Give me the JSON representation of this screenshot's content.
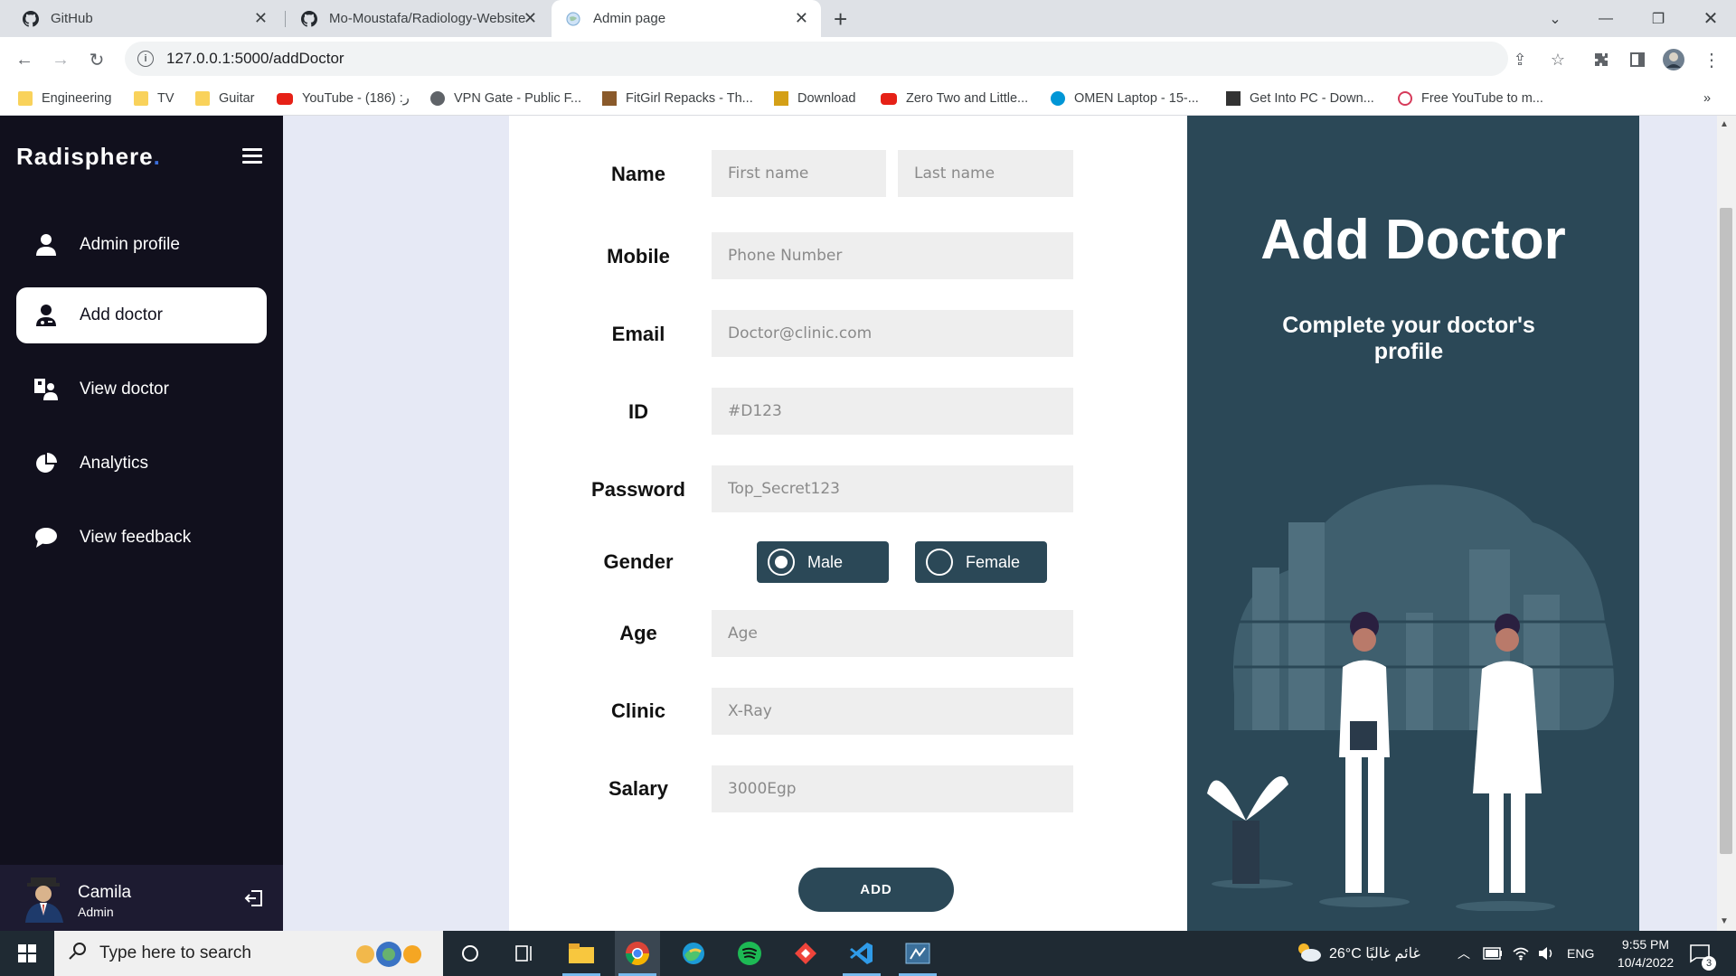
{
  "browser": {
    "tabs": [
      {
        "title": "GitHub",
        "close": "✕"
      },
      {
        "title": "Mo-Moustafa/Radiology-Website",
        "close": "✕"
      },
      {
        "title": "Admin page",
        "close": "✕"
      }
    ],
    "new_tab": "+",
    "url": "127.0.0.1:5000/addDoctor",
    "bookmarks": [
      {
        "label": "Engineering",
        "color": "#f9d25b"
      },
      {
        "label": "TV",
        "color": "#f9d25b"
      },
      {
        "label": "Guitar",
        "color": "#f9d25b"
      },
      {
        "label": "YouTube - ر: (186)",
        "color": "#e62117"
      },
      {
        "label": "VPN Gate - Public F...",
        "color": "#5f6368"
      },
      {
        "label": "FitGirl Repacks - Th...",
        "color": "#8a5a2b"
      },
      {
        "label": "Download",
        "color": "#d4a017"
      },
      {
        "label": "Zero Two and Little...",
        "color": "#e62117"
      },
      {
        "label": "OMEN Laptop - 15-...",
        "color": "#0096d6"
      },
      {
        "label": "Get Into PC - Down...",
        "color": "#333333"
      },
      {
        "label": "Free YouTube to m...",
        "color": "#d63a5a"
      }
    ],
    "more_bookmarks": "»"
  },
  "sidebar": {
    "brand": "Radisphere",
    "brand_dot": ".",
    "items": [
      {
        "label": "Admin profile",
        "icon": "user-icon"
      },
      {
        "label": "Add doctor",
        "icon": "user-doctor-icon"
      },
      {
        "label": "View doctor",
        "icon": "id-card-icon"
      },
      {
        "label": "Analytics",
        "icon": "pie-chart-icon"
      },
      {
        "label": "View feedback",
        "icon": "chat-bubble-icon"
      }
    ],
    "active_index": 1,
    "profile": {
      "name": "Camila",
      "role": "Admin"
    }
  },
  "form": {
    "fields": {
      "name": {
        "label": "Name",
        "first_placeholder": "First name",
        "last_placeholder": "Last name"
      },
      "mobile": {
        "label": "Mobile",
        "placeholder": "Phone Number"
      },
      "email": {
        "label": "Email",
        "placeholder": "Doctor@clinic.com"
      },
      "id": {
        "label": "ID",
        "placeholder": "#D123"
      },
      "password": {
        "label": "Password",
        "placeholder": "Top_Secret123"
      },
      "gender": {
        "label": "Gender",
        "options": [
          "Male",
          "Female"
        ],
        "selected": "Male"
      },
      "age": {
        "label": "Age",
        "placeholder": "Age"
      },
      "clinic": {
        "label": "Clinic",
        "placeholder": "X-Ray"
      },
      "salary": {
        "label": "Salary",
        "placeholder": "3000Egp"
      }
    },
    "submit_label": "ADD"
  },
  "panel": {
    "title": "Add Doctor",
    "subtitle": "Complete your doctor's profile"
  },
  "taskbar": {
    "search_placeholder": "Type here to search",
    "weather": "26°C  غائم غالبًا",
    "language": "ENG",
    "time": "9:55 PM",
    "date": "10/4/2022",
    "notifications": "3"
  },
  "colors": {
    "sidebar": "#11101d",
    "accent": "#2b4857",
    "background": "#e6e9f5"
  }
}
